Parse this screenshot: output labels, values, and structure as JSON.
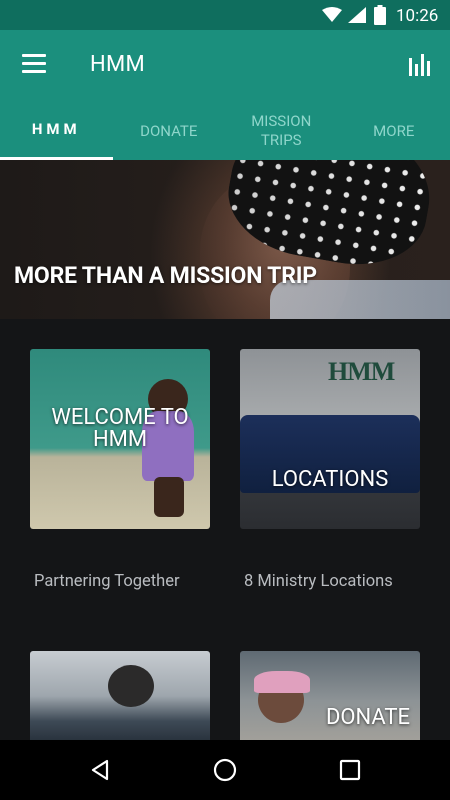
{
  "status_bar": {
    "time": "10:26",
    "icons": [
      "wifi-icon",
      "signal-icon",
      "battery-icon"
    ]
  },
  "app_bar": {
    "title": "HMM",
    "menu_icon": "hamburger-menu-icon",
    "action_icon": "bar-chart-icon"
  },
  "tabs": [
    {
      "label": "HMM",
      "active": true
    },
    {
      "label": "DONATE",
      "active": false
    },
    {
      "label": "MISSION TRIPS",
      "active": false
    },
    {
      "label": "MORE",
      "active": false
    }
  ],
  "hero": {
    "text": "MORE THAN A MISSION TRIP"
  },
  "cards": [
    {
      "label": "WELCOME TO HMM",
      "caption": "Partnering Together"
    },
    {
      "label": "LOCATIONS",
      "caption": "8 Ministry Locations",
      "logo_text": "HMM"
    },
    {
      "label": ""
    },
    {
      "label": "DONATE"
    }
  ],
  "nav_bar": {
    "icons": [
      "back-icon",
      "home-icon",
      "recent-apps-icon"
    ]
  },
  "colors": {
    "status_bar": "#0f6e5e",
    "app_bar": "#1b8f7d",
    "tab_inactive": "#8fd6cb",
    "background": "#141517",
    "caption": "#b9bcc0"
  }
}
